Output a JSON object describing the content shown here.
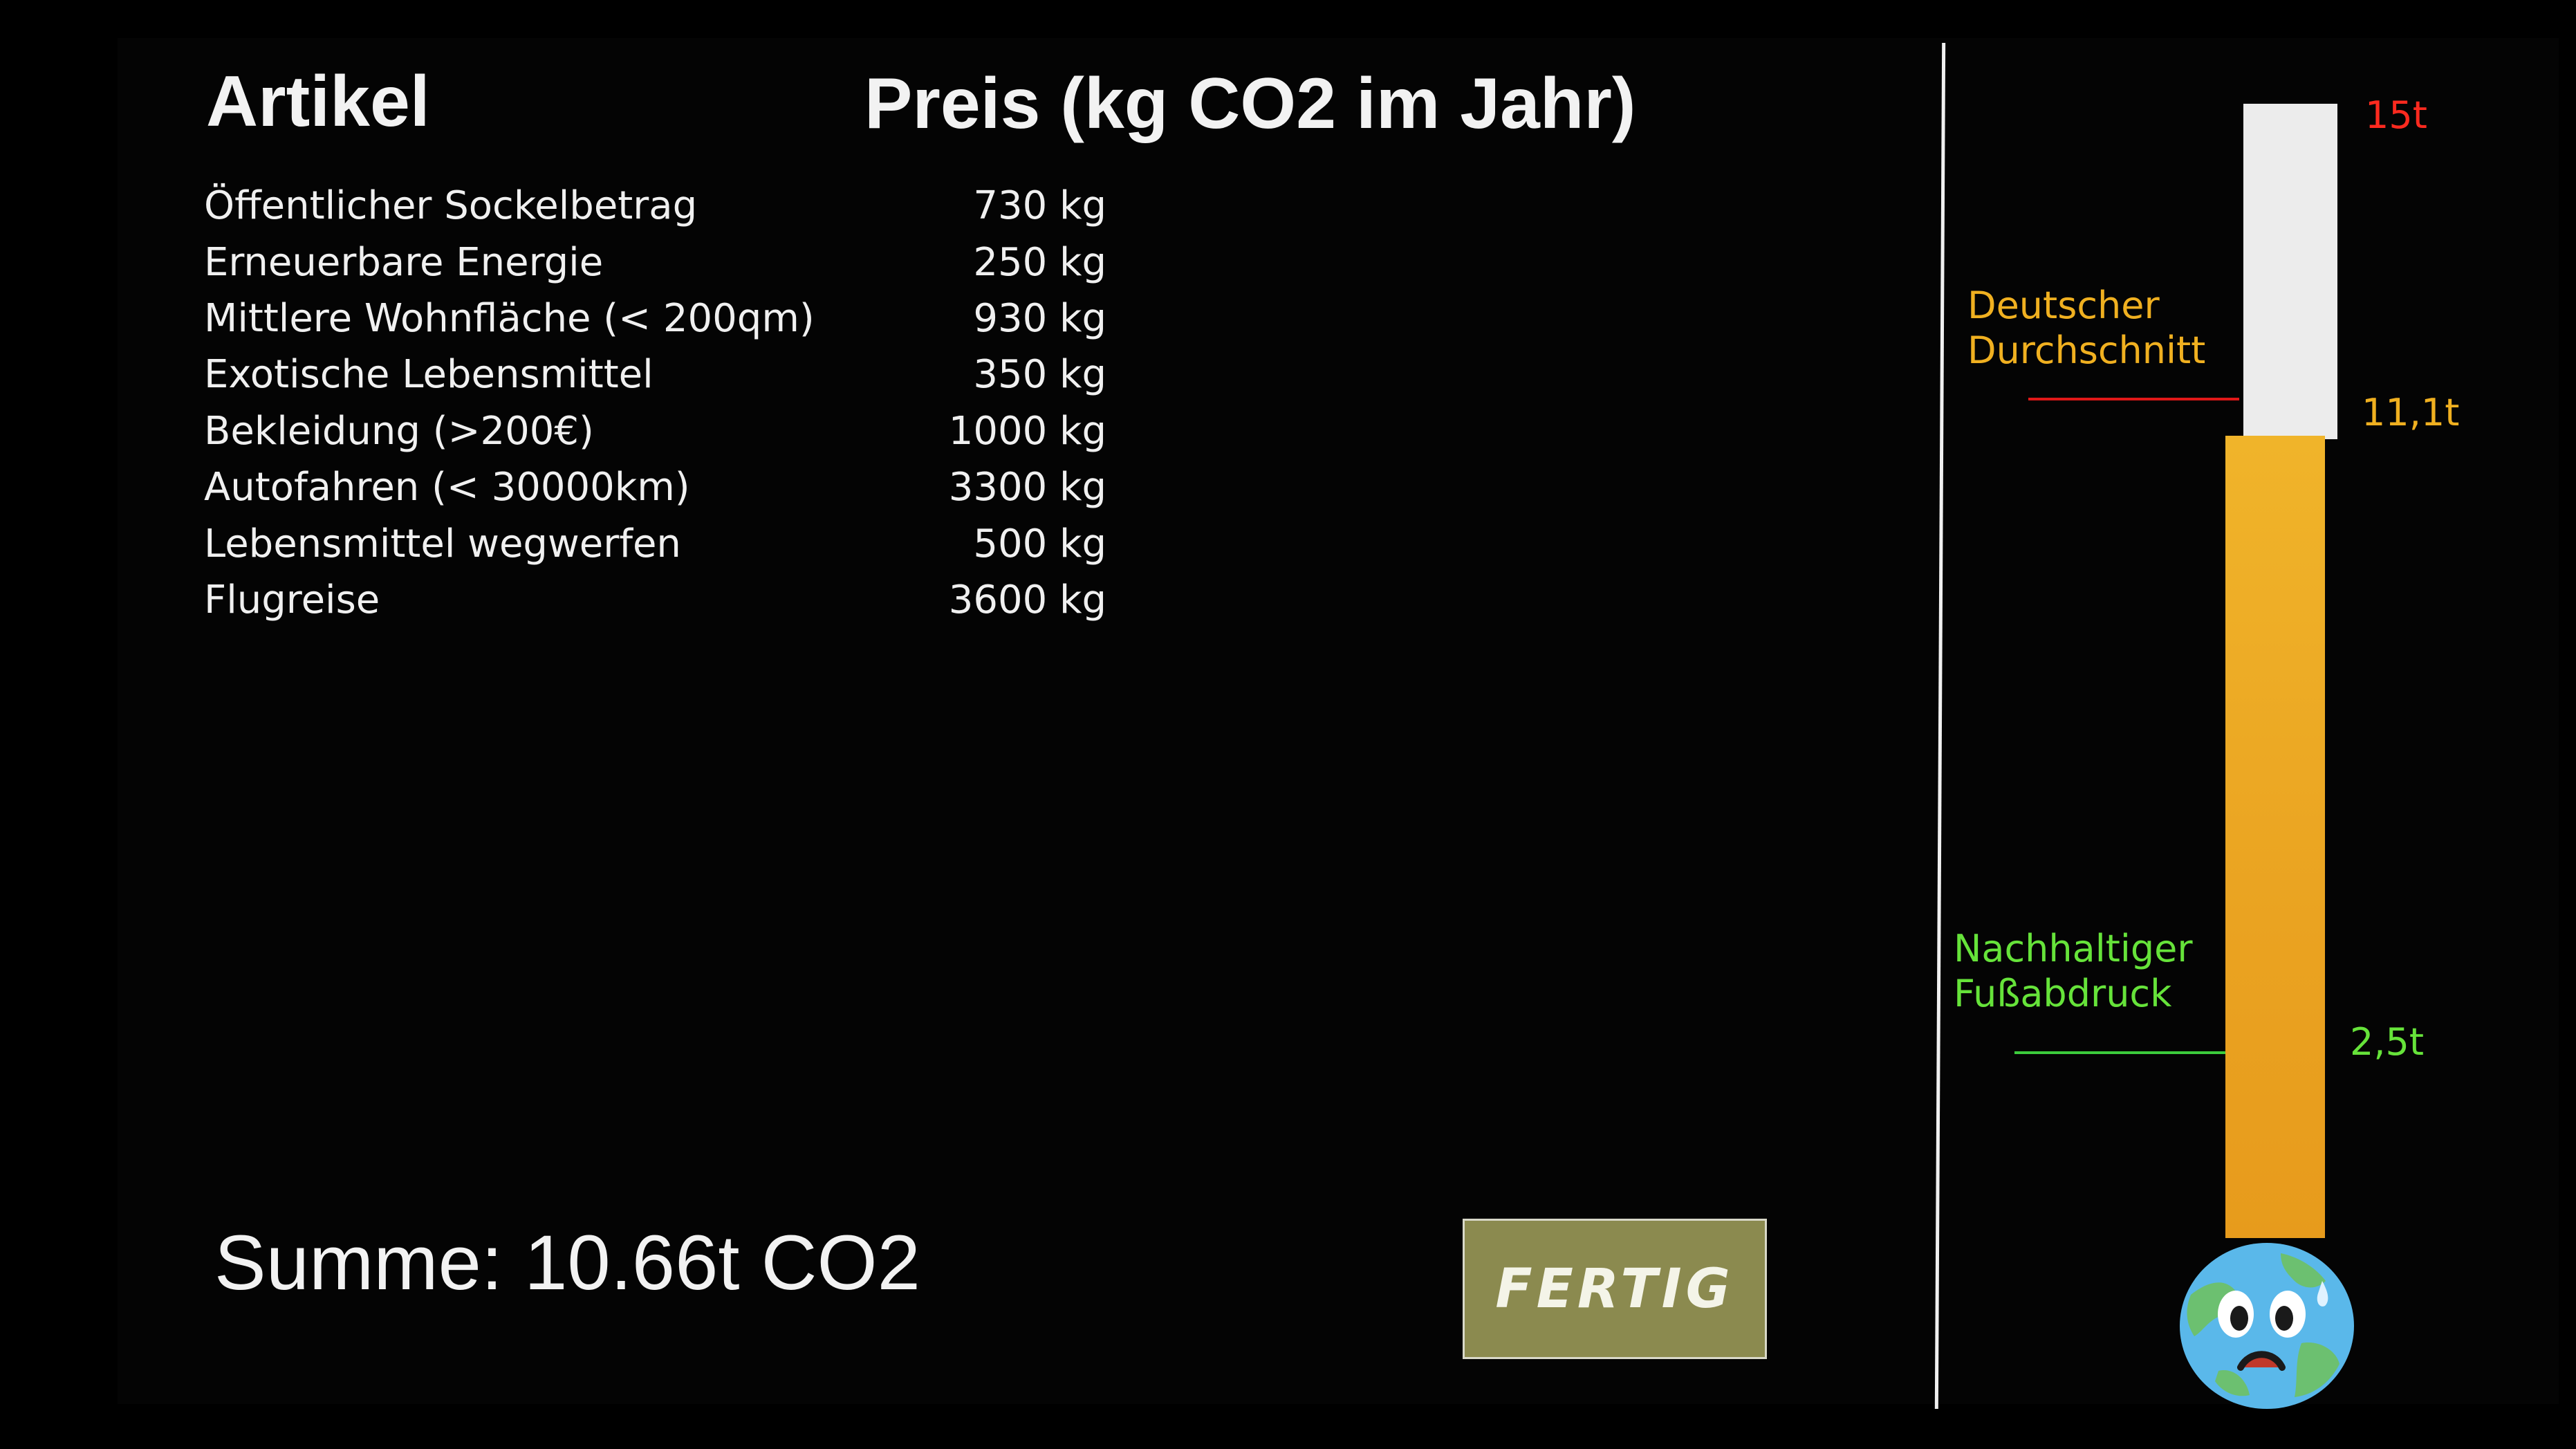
{
  "header": {
    "col_item": "Artikel",
    "col_price": "Preis (kg CO2 im Jahr)"
  },
  "items": [
    {
      "name": "Öffentlicher Sockelbetrag",
      "price": "730 kg"
    },
    {
      "name": "Erneuerbare Energie",
      "price": "250 kg"
    },
    {
      "name": "Mittlere Wohnfläche (< 200qm)",
      "price": "930 kg"
    },
    {
      "name": "Exotische Lebensmittel",
      "price": "350 kg"
    },
    {
      "name": "Bekleidung (>200€)",
      "price": "1000 kg"
    },
    {
      "name": "Autofahren (< 30000km)",
      "price": "3300 kg"
    },
    {
      "name": "Lebensmittel wegwerfen",
      "price": "500 kg"
    },
    {
      "name": "Flugreise",
      "price": "3600 kg"
    }
  ],
  "summary": {
    "sum_text": "Summe: 10.66t CO2"
  },
  "buttons": {
    "done_label": "FERTIG"
  },
  "thermometer": {
    "max_label": "15t",
    "avg_label": "Deutscher Durchschnitt",
    "avg_value": "11,1t",
    "sustainable_label": "Nachhaltiger Fußabdruck",
    "sustainable_value": "2,5t",
    "current_fraction": 0.7107
  },
  "colors": {
    "max": "#ff2a1f",
    "average": "#f0b020",
    "sustainable": "#66e33a",
    "fill": "#eaa321",
    "button": "#8b8a4f"
  },
  "icons": {
    "status": "sad-earth-icon"
  }
}
